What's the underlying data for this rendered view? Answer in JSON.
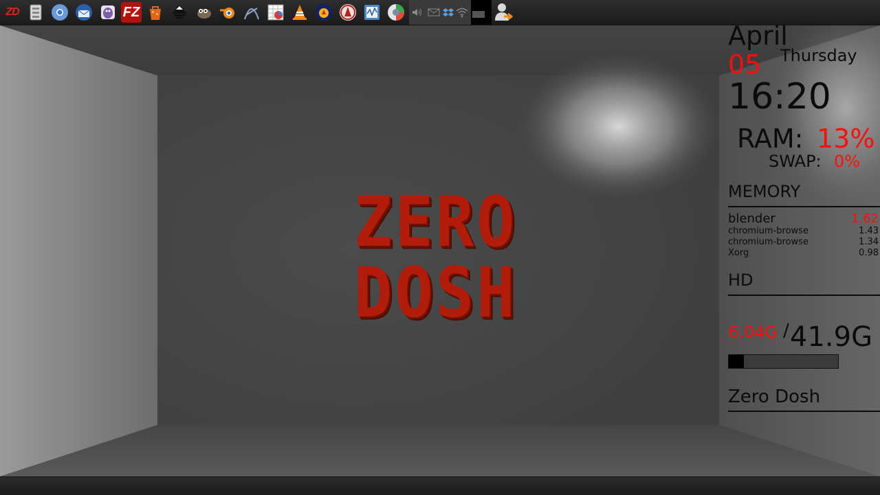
{
  "panel": {
    "launchers": [
      {
        "name": "zd-menu-icon",
        "label": "ZD"
      },
      {
        "name": "file-manager-icon"
      },
      {
        "name": "chromium-icon"
      },
      {
        "name": "thunderbird-icon"
      },
      {
        "name": "pidgin-icon"
      },
      {
        "name": "filezilla-icon",
        "label": "FZ"
      },
      {
        "name": "package-manager-icon"
      },
      {
        "name": "inkscape-icon"
      },
      {
        "name": "gimp-icon"
      },
      {
        "name": "blender-icon"
      },
      {
        "name": "vector-tool-icon"
      },
      {
        "name": "spreadsheet-icon"
      },
      {
        "name": "vlc-icon"
      },
      {
        "name": "audio-player-icon"
      },
      {
        "name": "game-icon"
      },
      {
        "name": "system-monitor-icon"
      },
      {
        "name": "photo-app-icon"
      }
    ],
    "tray": [
      "volume-icon",
      "mail-icon",
      "dropbox-icon",
      "wifi-icon"
    ],
    "user": "user-logout-icon"
  },
  "logo": {
    "line1": "ZERO",
    "line2": "DOSH"
  },
  "conky": {
    "month": "April",
    "day": "05",
    "weekday": "Thursday",
    "time": "16:20",
    "ram_label": "RAM:",
    "ram_value": "13%",
    "swap_label": "SWAP:",
    "swap_value": "0%",
    "memory_header": "MEMORY",
    "processes": [
      {
        "name": "blender",
        "value": "1.62"
      },
      {
        "name": "chromium-browse",
        "value": "1.43"
      },
      {
        "name": "chromium-browse",
        "value": "1.34"
      },
      {
        "name": "Xorg",
        "value": "0.98"
      }
    ],
    "hd_header": "HD",
    "hd_used": "6.04G",
    "hd_sep": "/",
    "hd_total": "41.9G",
    "hd_fraction": 0.14,
    "footer": "Zero Dosh"
  },
  "colors": {
    "accent": "#ff0d0d",
    "logo": "#b11c0b",
    "panel": "#222222"
  }
}
